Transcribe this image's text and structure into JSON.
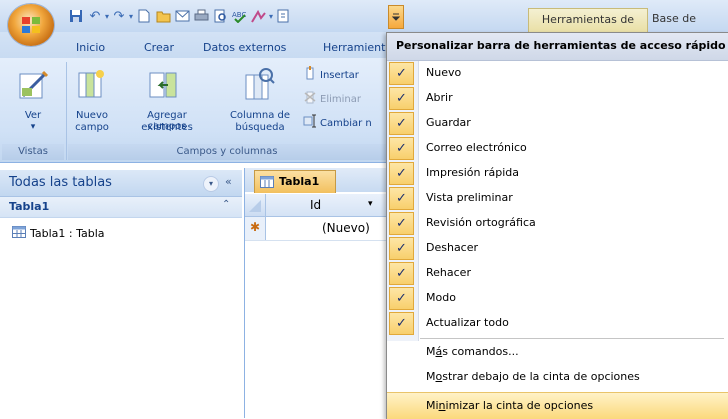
{
  "title_bar": {
    "context_tab": "Herramientas de tabla",
    "title_rest": "Base de"
  },
  "ribbon": {
    "tabs": [
      "Inicio",
      "Crear",
      "Datos externos",
      "Herramient"
    ],
    "views_group": {
      "button": "Ver",
      "caption": "Vistas"
    },
    "fields_group": {
      "new_field": [
        "Nuevo",
        "campo"
      ],
      "add_existing": [
        "Agregar campos",
        "existentes"
      ],
      "lookup_column": [
        "Columna de",
        "búsqueda"
      ],
      "insert": "Insertar",
      "delete": "Eliminar",
      "rename": "Cambiar n",
      "caption": "Campos y columnas"
    }
  },
  "nav_pane": {
    "title": "Todas las tablas",
    "group": "Tabla1",
    "items": [
      {
        "label": "Tabla1 : Tabla"
      }
    ]
  },
  "document": {
    "tab": "Tabla1",
    "column_header": "Id",
    "new_row_marker": "✱",
    "new_row_value": "(Nuevo)"
  },
  "menu": {
    "title": "Personalizar barra de herramientas de acceso rápido",
    "checked_items": [
      {
        "label": "Nuevo",
        "checked": true
      },
      {
        "label": "Abrir",
        "checked": true
      },
      {
        "label": "Guardar",
        "checked": true
      },
      {
        "label": "Correo electrónico",
        "checked": true
      },
      {
        "label": "Impresión rápida",
        "checked": true
      },
      {
        "label": "Vista preliminar",
        "checked": true
      },
      {
        "label": "Revisión ortográfica",
        "checked": true
      },
      {
        "label": "Deshacer",
        "checked": true
      },
      {
        "label": "Rehacer",
        "checked": true
      },
      {
        "label": "Modo",
        "checked": true
      },
      {
        "label": "Actualizar todo",
        "checked": true
      }
    ],
    "more_commands": {
      "prefix": "M",
      "accel": "á",
      "rest": "s comandos..."
    },
    "show_below": {
      "prefix": "M",
      "accel": "o",
      "rest": "strar debajo de la cinta de opciones"
    },
    "minimize": {
      "prefix": "Mi",
      "accel": "n",
      "rest": "imizar la cinta de opciones"
    }
  },
  "colors": {
    "accent": "#15428b",
    "highlight": "#fbd97c",
    "checkbox": "#f8cf6c"
  }
}
